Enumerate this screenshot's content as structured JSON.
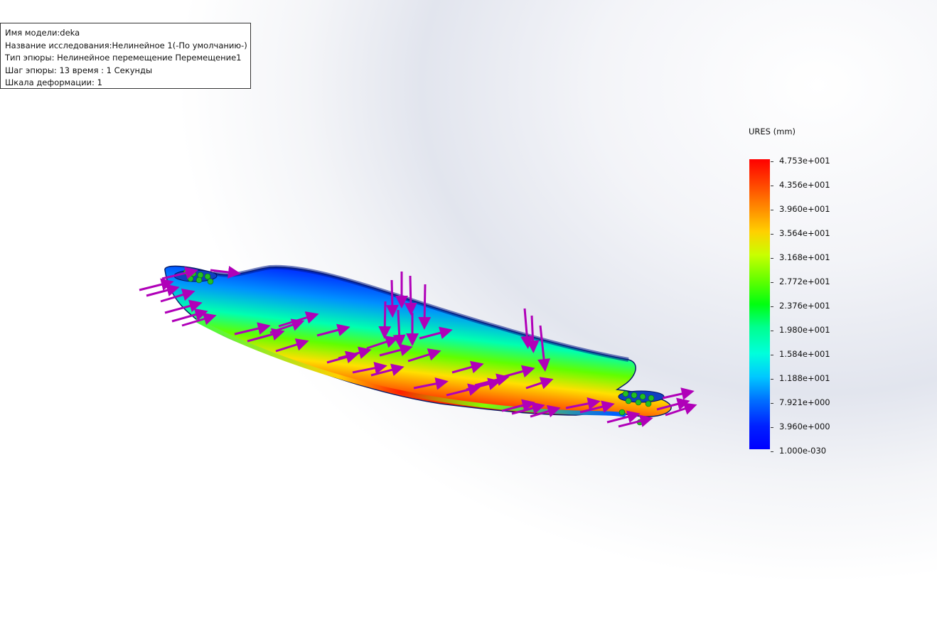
{
  "info": {
    "model_name": "Имя модели:deka",
    "study_name": "Название исследования:Нелинейное 1(-По умолчанию-)",
    "plot_type": "Тип эпюры: Нелинейное перемещение Перемещение1",
    "plot_step": "Шаг эпюры: 13   время : 1 Секунды",
    "deformation_scale": "Шкала деформации: 1"
  },
  "legend": {
    "title": "URES (mm)",
    "labels": [
      "4.753e+001",
      "4.356e+001",
      "3.960e+001",
      "3.564e+001",
      "3.168e+001",
      "2.772e+001",
      "2.376e+001",
      "1.980e+001",
      "1.584e+001",
      "1.188e+001",
      "7.921e+000",
      "3.960e+000",
      "1.000e-030"
    ]
  },
  "colors": {
    "max": "#ff0000",
    "min": "#0000ff",
    "load_arrows": "#c000c0",
    "fixtures": "#00b000"
  }
}
